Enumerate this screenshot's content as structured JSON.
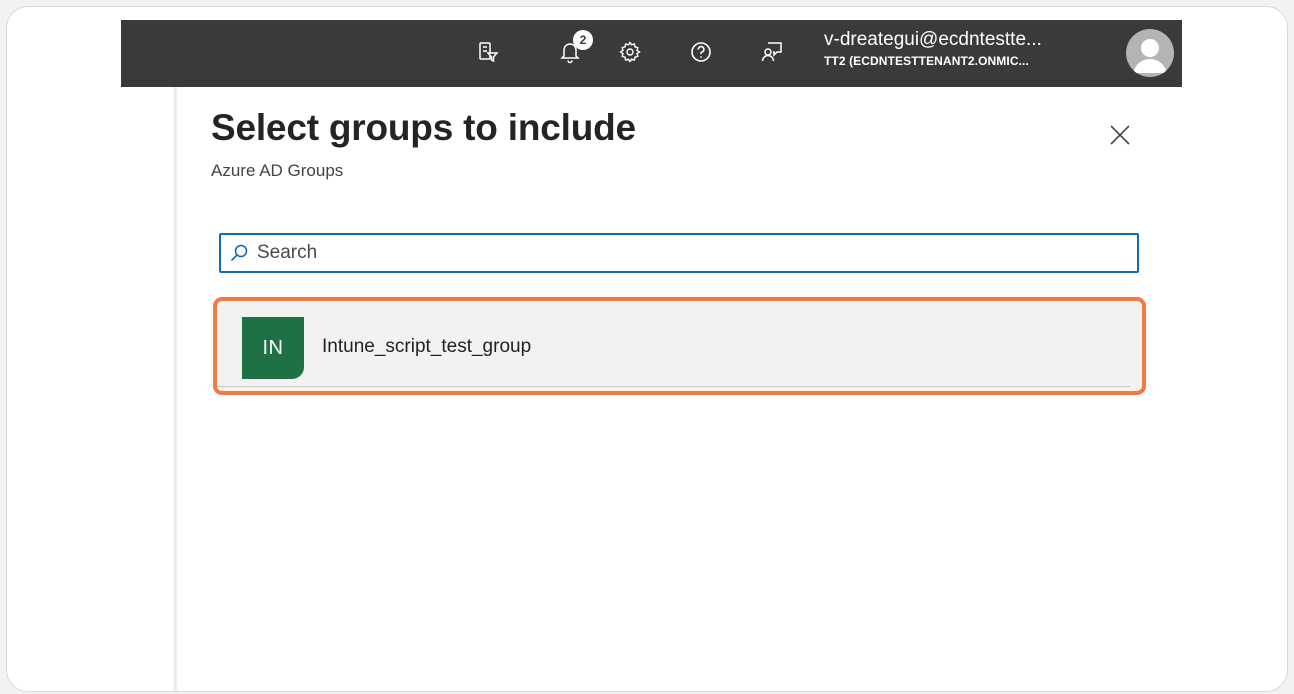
{
  "topbar": {
    "icons": [
      {
        "name": "portal-filter-icon"
      },
      {
        "name": "notifications-icon",
        "badge": "2"
      },
      {
        "name": "settings-gear-icon"
      },
      {
        "name": "help-icon"
      },
      {
        "name": "feedback-icon"
      }
    ],
    "account": {
      "name": "v-dreategui@ecdntestte...",
      "tenant": "TT2 (ECDNTESTTENANT2.ONMIC..."
    },
    "colors": {
      "background": "#3b3a39"
    }
  },
  "panel": {
    "title": "Select groups to include",
    "subtitle": "Azure AD Groups",
    "search": {
      "placeholder": "Search",
      "value": ""
    },
    "results": [
      {
        "initials": "IN",
        "name": "Intune_script_test_group",
        "avatar_color": "#1e7145"
      }
    ],
    "colors": {
      "highlight": "#f47a45",
      "focus": "#0f6cbd"
    }
  }
}
